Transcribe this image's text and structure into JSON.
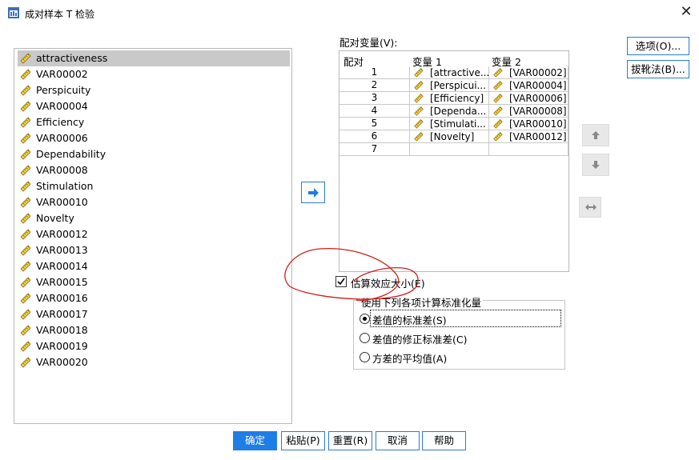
{
  "window": {
    "title": "成对样本 T 检验",
    "close_glyph": "✕"
  },
  "variables": [
    "attractiveness",
    "VAR00002",
    "Perspicuity",
    "VAR00004",
    "Efficiency",
    "VAR00006",
    "Dependability",
    "VAR00008",
    "Stimulation",
    "VAR00010",
    "Novelty",
    "VAR00012",
    "VAR00013",
    "VAR00014",
    "VAR00015",
    "VAR00016",
    "VAR00017",
    "VAR00018",
    "VAR00019",
    "VAR00020"
  ],
  "pairs_panel": {
    "label": "配对变量(V):",
    "columns": [
      "配对",
      "变量 1",
      "变量 2"
    ],
    "rows": [
      {
        "n": "1",
        "v1": "[attractive...",
        "v2": "[VAR00002]"
      },
      {
        "n": "2",
        "v1": "[Perspicui...",
        "v2": "[VAR00004]"
      },
      {
        "n": "3",
        "v1": "[Efficiency]",
        "v2": "[VAR00006]"
      },
      {
        "n": "4",
        "v1": "[Dependa...",
        "v2": "[VAR00008]"
      },
      {
        "n": "5",
        "v1": "[Stimulati...",
        "v2": "[VAR00010]"
      },
      {
        "n": "6",
        "v1": "[Novelty]",
        "v2": "[VAR00012]"
      },
      {
        "n": "7",
        "v1": "",
        "v2": ""
      }
    ]
  },
  "right_buttons": {
    "options": "选项(O)...",
    "bootstrap": "拔靴法(B)..."
  },
  "effect_size": {
    "label": "估算效应大小(E)",
    "checked": true
  },
  "standardizer_group": {
    "title": "使用下列各项计算标准化量",
    "options": [
      {
        "label": "差值的标准差(S)",
        "selected": true
      },
      {
        "label": "差值的修正标准差(C)",
        "selected": false
      },
      {
        "label": "方差的平均值(A)",
        "selected": false
      }
    ]
  },
  "bottom_buttons": {
    "ok": "确定",
    "paste": "粘贴(P)",
    "reset": "重置(R)",
    "cancel": "取消",
    "help": "帮助"
  },
  "icons": {
    "variable": "scale-ruler-icon",
    "move": "arrow-right-icon",
    "up": "arrow-up-icon",
    "down": "arrow-down-icon",
    "swap": "swap-icon"
  },
  "colors": {
    "accent": "#1e7ee6",
    "selection": "#c9c9c9",
    "annotation": "#d0201a"
  }
}
